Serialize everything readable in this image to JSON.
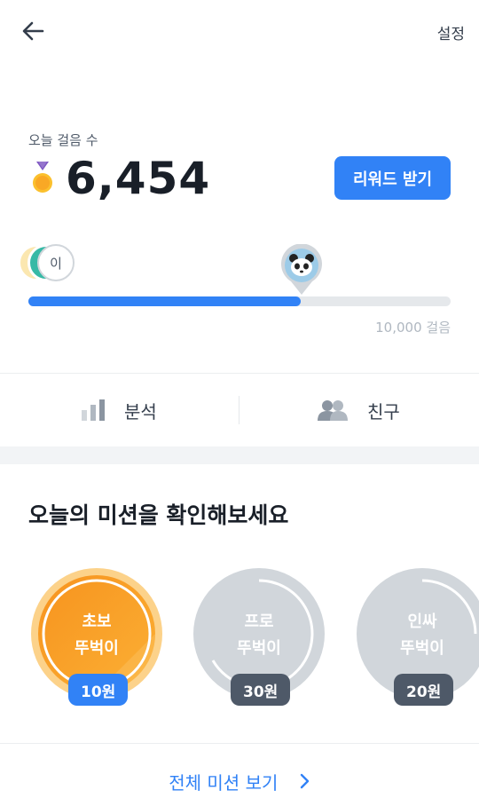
{
  "header": {
    "back_icon": "arrow-left-icon",
    "settings_label": "설정"
  },
  "steps": {
    "label": "오늘 걸음 수",
    "count": "6,454",
    "medal_icon": "medal-icon",
    "reward_button": "리워드 받기"
  },
  "progress": {
    "current_steps": 6454,
    "goal_steps": 10000,
    "fraction": 0.6454,
    "goal_label": "10,000 걸음",
    "friend_initial": "이",
    "me_avatar_icon": "panda-icon"
  },
  "tabs": [
    {
      "label": "분석",
      "icon": "bar-chart-icon"
    },
    {
      "label": "친구",
      "icon": "people-icon"
    }
  ],
  "missions": {
    "title": "오늘의 미션을 확인해보세요",
    "items": [
      {
        "line1": "초보",
        "line2": "뚜벅이",
        "reward": "10원",
        "active": true,
        "color": "#f9a825",
        "badge_color": "#3182f6"
      },
      {
        "line1": "프로",
        "line2": "뚜벅이",
        "reward": "30원",
        "active": false,
        "color": "#d1d6db",
        "badge_color": "#4e5968"
      },
      {
        "line1": "인싸",
        "line2": "뚜벅이",
        "reward": "20원",
        "active": false,
        "color": "#d1d6db",
        "badge_color": "#4e5968"
      }
    ],
    "see_all": "전체 미션 보기",
    "see_all_icon": "chevron-right-icon"
  },
  "colors": {
    "accent": "#3182f6",
    "orange": "#f9a825",
    "gray_track": "#e5e8eb"
  }
}
